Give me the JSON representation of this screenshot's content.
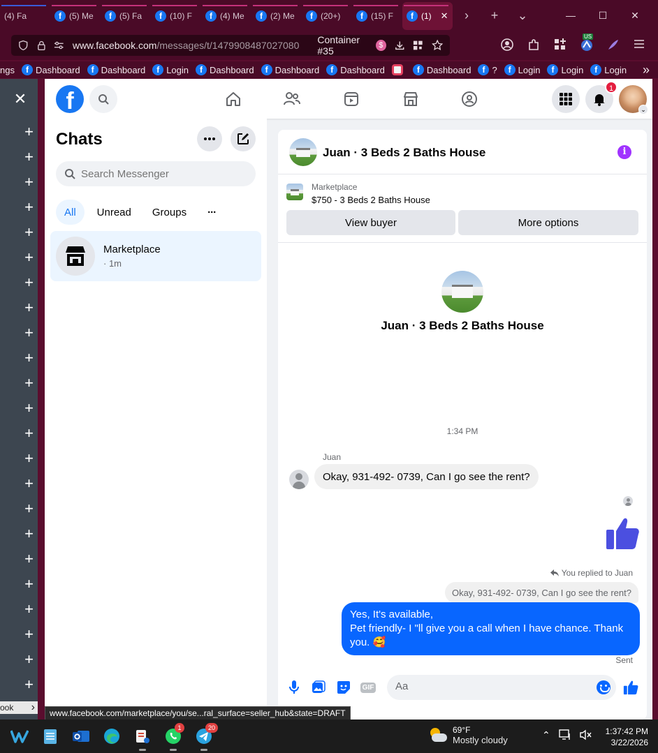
{
  "browser": {
    "tabs": [
      {
        "label": "(4) Fa"
      },
      {
        "label": "(5) Me"
      },
      {
        "label": "(5) Fa"
      },
      {
        "label": "(10) F"
      },
      {
        "label": "(4) Me"
      },
      {
        "label": "(2) Me"
      },
      {
        "label": "(20+)"
      },
      {
        "label": "(15) F"
      },
      {
        "label": "(1)"
      }
    ],
    "url_domain": "www.facebook.com",
    "url_path": "/messages/t/1479908487027080",
    "container_label": "Container #35",
    "container_badge": "$",
    "extension_badge": "US",
    "bookmarks": [
      {
        "label": "ngs",
        "icon": "none"
      },
      {
        "label": "Dashboard",
        "icon": "fb"
      },
      {
        "label": "Dashboard",
        "icon": "fb"
      },
      {
        "label": "Login",
        "icon": "fb"
      },
      {
        "label": "Dashboard",
        "icon": "fb"
      },
      {
        "label": "Dashboard",
        "icon": "fb"
      },
      {
        "label": "Dashboard",
        "icon": "fb"
      },
      {
        "label": "",
        "icon": "instagram"
      },
      {
        "label": "Dashboard",
        "icon": "fb"
      },
      {
        "label": "?",
        "icon": "fb"
      },
      {
        "label": "Login",
        "icon": "fb"
      },
      {
        "label": "Login",
        "icon": "fb"
      },
      {
        "label": "Login",
        "icon": "fb"
      }
    ],
    "overflow_chevron": "»"
  },
  "sidebar": {
    "close_glyph": "✕",
    "plus_glyph": "+",
    "bottom_label": "ook",
    "bottom_chevron": "›"
  },
  "header": {
    "logo_letter": "f",
    "notifications_count": "1"
  },
  "chats": {
    "title": "Chats",
    "search_placeholder": "Search Messenger",
    "filters": [
      "All",
      "Unread",
      "Groups"
    ],
    "more_glyph": "···",
    "items": [
      {
        "name": "Marketplace",
        "meta": "· 1m"
      }
    ]
  },
  "conversation": {
    "title": "Juan · 3 Beds 2 Baths House",
    "info_glyph": "i",
    "marketplace_label": "Marketplace",
    "listing": "$750 - 3 Beds 2 Baths House",
    "view_buyer": "View buyer",
    "more_options": "More options",
    "intro_title": "Juan · 3 Beds 2 Baths House",
    "timestamp": "1:34 PM",
    "sender_name": "Juan",
    "incoming_message": "Okay, 931-492- 0739, Can I go see the rent?",
    "replied_label": "You replied to Juan",
    "quoted_message": "Okay, 931-492- 0739, Can I go see the rent?",
    "outgoing_lines": [
      "Yes, It's available,",
      "Pet friendly- I \"ll give you a call when I have chance. Thank you. 🥰"
    ],
    "sent_label": "Sent",
    "composer_placeholder": "Aa",
    "gif_label": "GIF"
  },
  "status_link": "www.facebook.com/marketplace/you/se...ral_surface=seller_hub&state=DRAFT",
  "taskbar": {
    "whatsapp_badge": "1",
    "telegram_badge": "20",
    "weather_temp": "69°F",
    "weather_desc": "Mostly cloudy",
    "time": "1:37:42 PM",
    "date": "3/22/2026"
  },
  "colors": {
    "accent": "#0866ff",
    "facebook_blue": "#1877f2",
    "browser_frame": "#4a0a27",
    "badge_red": "#e41e3f",
    "info_purple": "#a033ff"
  }
}
